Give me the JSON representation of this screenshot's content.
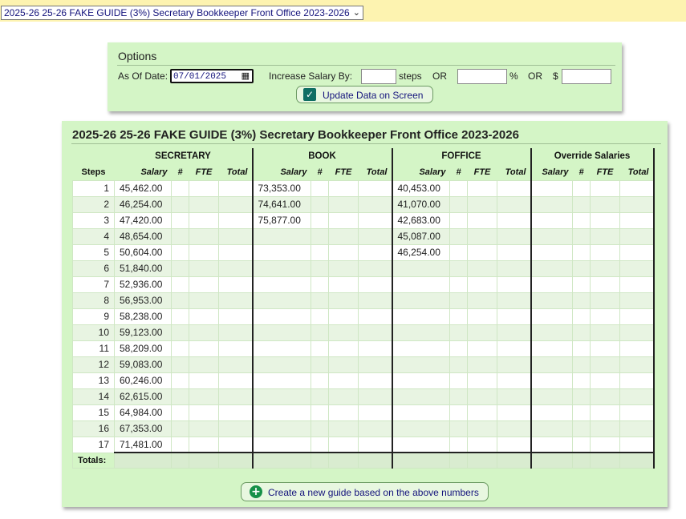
{
  "guide_select": {
    "value": "2025-26 25-26 FAKE GUIDE (3%) Secretary Bookkeeper Front Office 2023-2026"
  },
  "options": {
    "title": "Options",
    "as_of_label": "As Of Date:",
    "as_of_value": "07/01/2025",
    "increase_label": "Increase Salary By:",
    "steps_label": "steps",
    "or_label_1": "OR",
    "percent_label": "%",
    "or_label_2": "OR",
    "dollar_label": "$",
    "update_button": "Update Data on Screen"
  },
  "guide": {
    "title": "2025-26 25-26 FAKE GUIDE (3%) Secretary Bookkeeper Front Office 2023-2026",
    "groups": [
      {
        "name": "SECRETARY"
      },
      {
        "name": "BOOK"
      },
      {
        "name": "FOFFICE"
      },
      {
        "name": "Override Salaries"
      }
    ],
    "col_headers": {
      "steps": "Steps",
      "salary": "Salary",
      "count": "#",
      "fte": "FTE",
      "total": "Total"
    },
    "totals_label": "Totals:",
    "rows": [
      {
        "step": "1",
        "secretary": "45,462.00",
        "book": "73,353.00",
        "foffice": "40,453.00"
      },
      {
        "step": "2",
        "secretary": "46,254.00",
        "book": "74,641.00",
        "foffice": "41,070.00"
      },
      {
        "step": "3",
        "secretary": "47,420.00",
        "book": "75,877.00",
        "foffice": "42,683.00"
      },
      {
        "step": "4",
        "secretary": "48,654.00",
        "book": "",
        "foffice": "45,087.00"
      },
      {
        "step": "5",
        "secretary": "50,604.00",
        "book": "",
        "foffice": "46,254.00"
      },
      {
        "step": "6",
        "secretary": "51,840.00",
        "book": "",
        "foffice": ""
      },
      {
        "step": "7",
        "secretary": "52,936.00",
        "book": "",
        "foffice": ""
      },
      {
        "step": "8",
        "secretary": "56,953.00",
        "book": "",
        "foffice": ""
      },
      {
        "step": "9",
        "secretary": "58,238.00",
        "book": "",
        "foffice": ""
      },
      {
        "step": "10",
        "secretary": "59,123.00",
        "book": "",
        "foffice": ""
      },
      {
        "step": "11",
        "secretary": "58,209.00",
        "book": "",
        "foffice": ""
      },
      {
        "step": "12",
        "secretary": "59,083.00",
        "book": "",
        "foffice": ""
      },
      {
        "step": "13",
        "secretary": "60,246.00",
        "book": "",
        "foffice": ""
      },
      {
        "step": "14",
        "secretary": "62,615.00",
        "book": "",
        "foffice": ""
      },
      {
        "step": "15",
        "secretary": "64,984.00",
        "book": "",
        "foffice": ""
      },
      {
        "step": "16",
        "secretary": "67,353.00",
        "book": "",
        "foffice": ""
      },
      {
        "step": "17",
        "secretary": "71,481.00",
        "book": "",
        "foffice": ""
      }
    ]
  },
  "create_button": "Create a new guide based on the above numbers",
  "colors": {
    "top_bar": "#fdf3b0",
    "panel": "#d4f5c6",
    "row_alt": "#e8f4e2",
    "link_text": "#14137c",
    "check_icon": "#0f6e63",
    "plus_icon": "#169048"
  },
  "icons": {
    "select_chevron": "chevron-down-icon",
    "date_picker": "calendar-icon",
    "update_button": "checkbox-checked-icon",
    "create_button": "plus-circle-icon"
  }
}
